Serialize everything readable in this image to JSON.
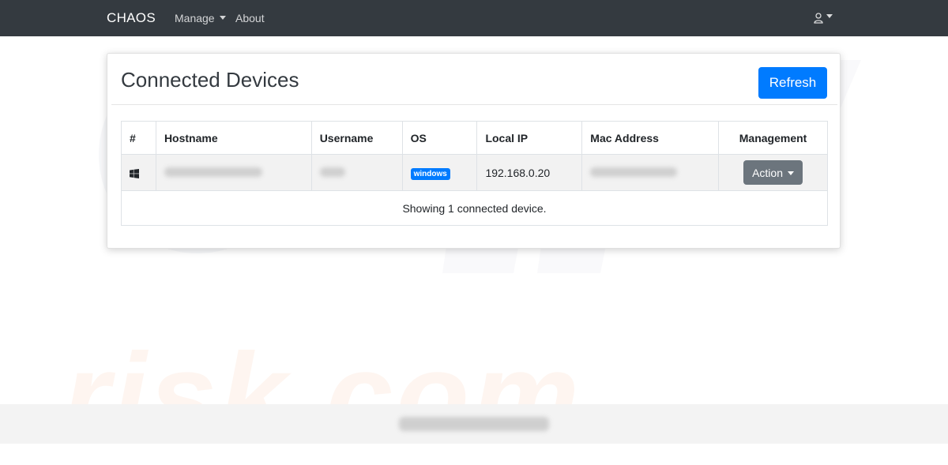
{
  "navbar": {
    "brand": "CHAOS",
    "items": [
      {
        "label": "Manage",
        "dropdown": true
      },
      {
        "label": "About",
        "dropdown": false
      }
    ],
    "user_icon": "user-icon"
  },
  "card": {
    "title": "Connected Devices",
    "refresh_label": "Refresh"
  },
  "table": {
    "columns": [
      "#",
      "Hostname",
      "Username",
      "OS",
      "Local IP",
      "Mac Address",
      "Management"
    ],
    "rows": [
      {
        "icon": "windows-icon",
        "hostname": "",
        "username": "",
        "os": "windows",
        "local_ip": "192.168.0.20",
        "mac_address": "",
        "action_label": "Action"
      }
    ],
    "footer_text": "Showing 1 connected device."
  },
  "watermark": {
    "text": "risk.com"
  },
  "colors": {
    "navbar": "#343a40",
    "primary": "#007bff",
    "secondary": "#6c757d",
    "watermark": "#f37828"
  }
}
